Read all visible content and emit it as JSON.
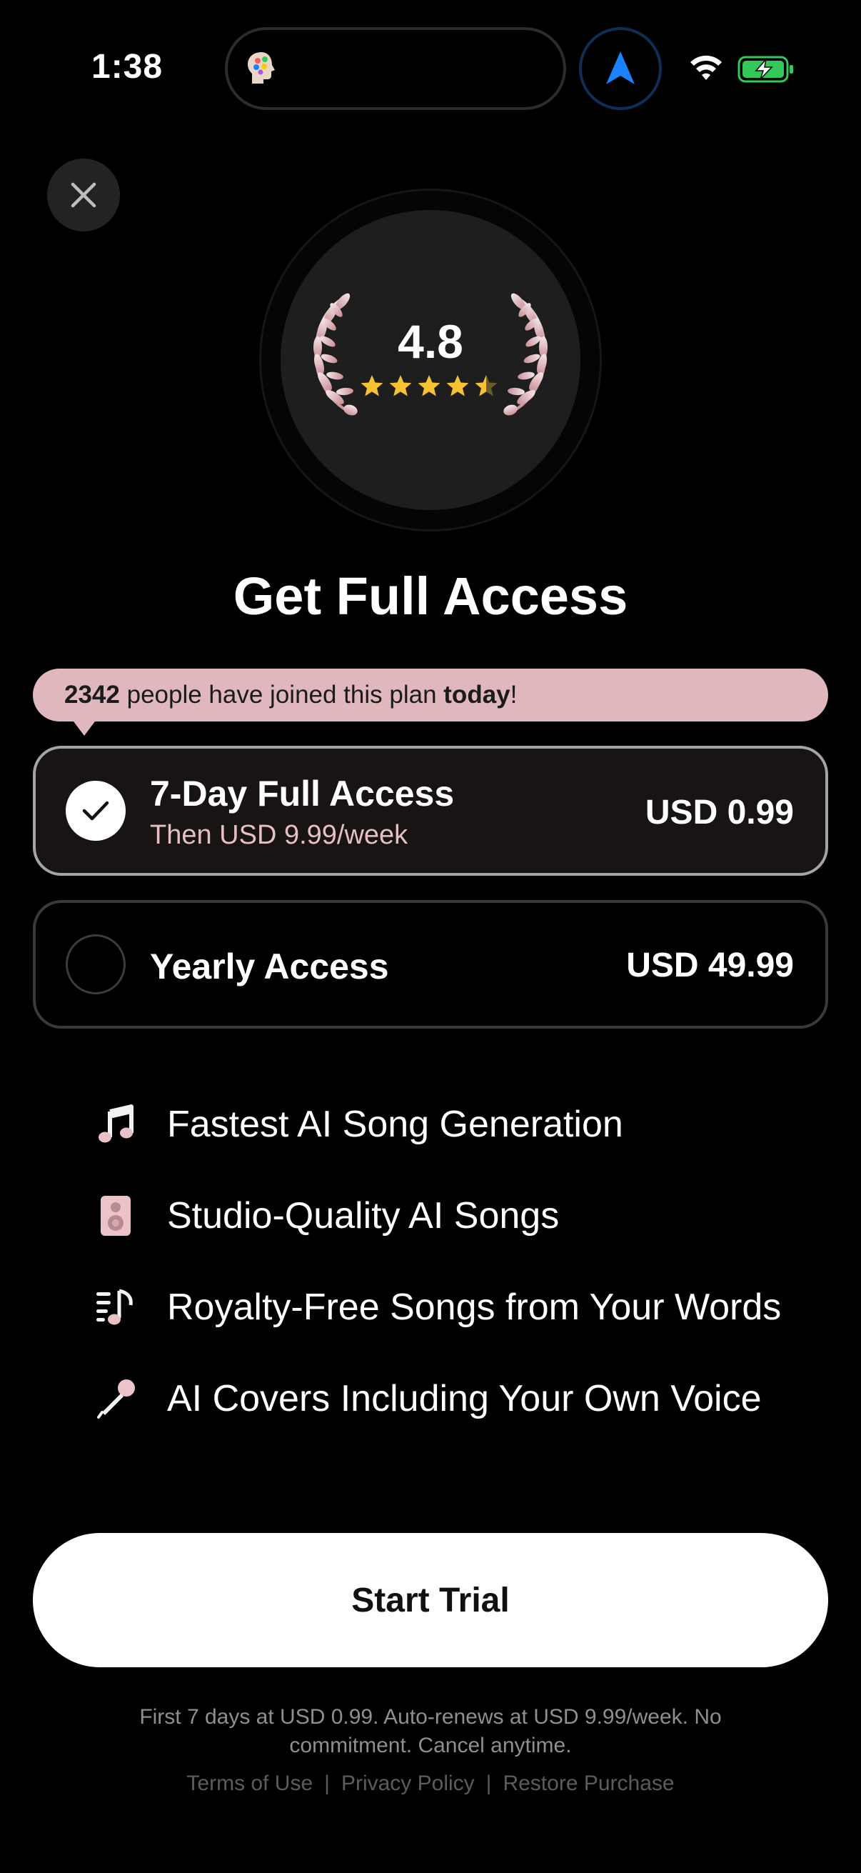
{
  "status_bar": {
    "time": "1:38"
  },
  "colors": {
    "accent_pink": "#dfb7bd",
    "star_gold": "#f5c233",
    "nav_blue": "#1a82ff",
    "battery_green": "#34c759"
  },
  "header": {
    "close_icon": "close-icon"
  },
  "rating": {
    "value": "4.8",
    "stars": 4.5
  },
  "title": "Get Full Access",
  "banner": {
    "count": "2342",
    "middle": " people have joined this plan ",
    "today": "today",
    "end": "!"
  },
  "plans": [
    {
      "name": "7-Day Full Access",
      "subtitle": "Then USD 9.99/week",
      "price": "USD 0.99",
      "selected": true
    },
    {
      "name": "Yearly Access",
      "price": "USD 49.99",
      "selected": false
    }
  ],
  "features": [
    {
      "icon": "music-note-icon",
      "text": "Fastest AI Song Generation"
    },
    {
      "icon": "speaker-icon",
      "text": "Studio-Quality AI Songs"
    },
    {
      "icon": "music-list-icon",
      "text": "Royalty-Free Songs from Your Words"
    },
    {
      "icon": "microphone-icon",
      "text": "AI Covers Including Your Own Voice"
    }
  ],
  "cta": {
    "label": "Start Trial"
  },
  "fine_print": "First 7 days at USD 0.99. Auto-renews at USD 9.99/week. No commitment. Cancel anytime.",
  "links": {
    "terms": "Terms of Use",
    "separator": "|",
    "privacy": "Privacy Policy",
    "restore": "Restore Purchase"
  }
}
